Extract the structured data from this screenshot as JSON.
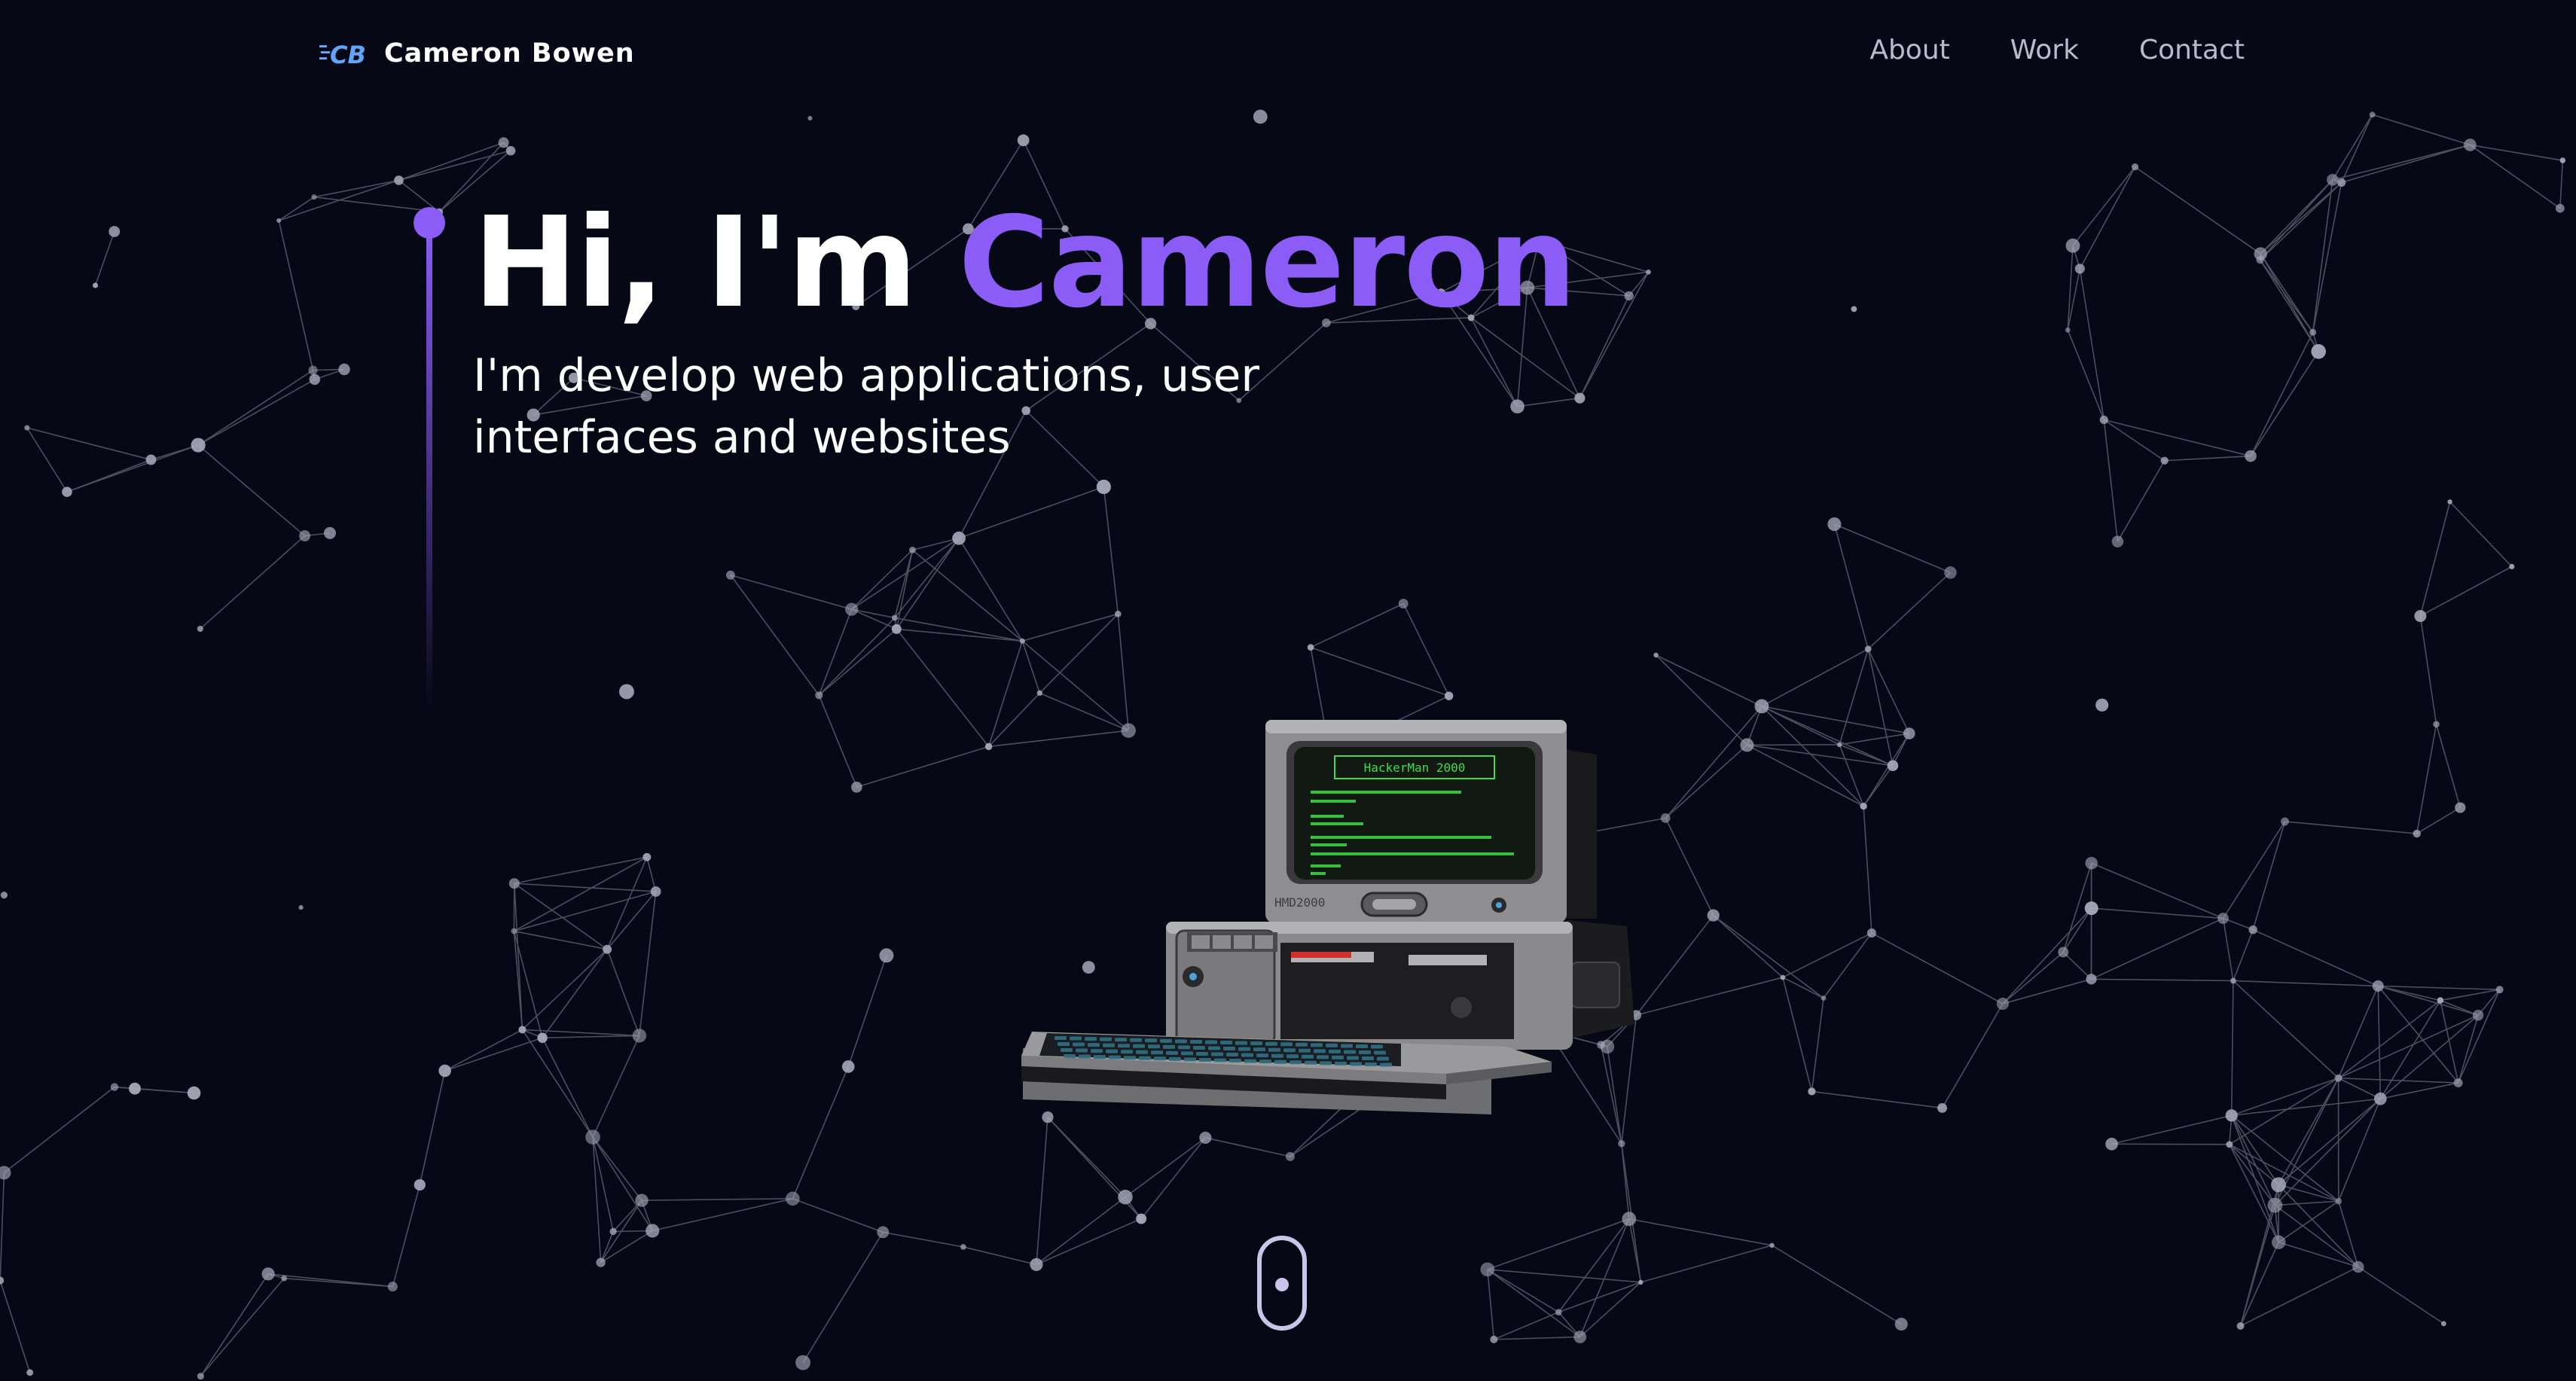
{
  "nav": {
    "logo_text": "CB",
    "brand_name": "Cameron Bowen",
    "links": [
      {
        "label": "About"
      },
      {
        "label": "Work"
      },
      {
        "label": "Contact"
      }
    ]
  },
  "hero": {
    "greeting": "Hi, I'm",
    "name": "Cameron",
    "subtitle": "I'm develop web applications, user interfaces and websites"
  },
  "computer": {
    "screen_header": "HackerMan 2000",
    "model_label": "HMD2000"
  },
  "theme": {
    "background": "#070816",
    "accent": "#8b5cf6",
    "nav_text": "#b9bbcc",
    "terminal_green": "#3ddc4a"
  }
}
